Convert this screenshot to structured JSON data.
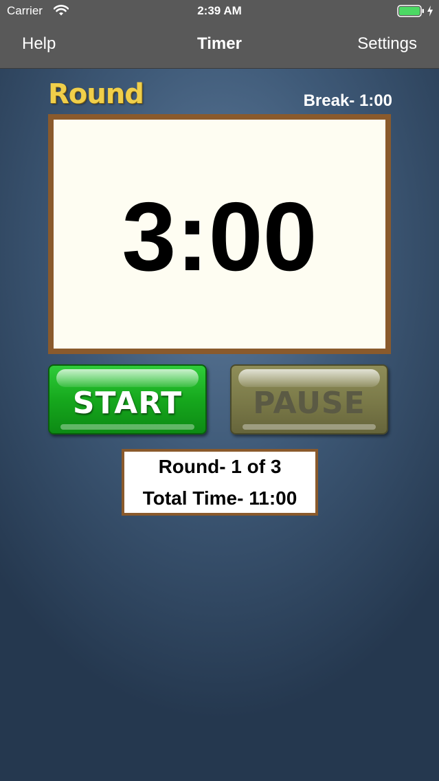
{
  "status_bar": {
    "carrier": "Carrier",
    "time": "2:39 AM",
    "wifi_icon": "wifi-icon",
    "battery_icon": "battery-icon",
    "charging_icon": "charging-icon",
    "battery_level": 1.0,
    "battery_color": "#4cd964"
  },
  "nav": {
    "left_label": "Help",
    "title": "Timer",
    "right_label": "Settings",
    "background": "#595959"
  },
  "timer": {
    "mode_label": "Round",
    "break_label": "Break- 1:00",
    "display": "3:00",
    "frame_color": "#8a5a2c",
    "mode_color": "#f0cf4a"
  },
  "controls": {
    "start_label": "START",
    "pause_label": "PAUSE",
    "start_color": "#16a81d",
    "pause_color": "#7a7948"
  },
  "info": {
    "round_text": "Round- 1 of 3",
    "total_text": "Total Time- 11:00"
  }
}
